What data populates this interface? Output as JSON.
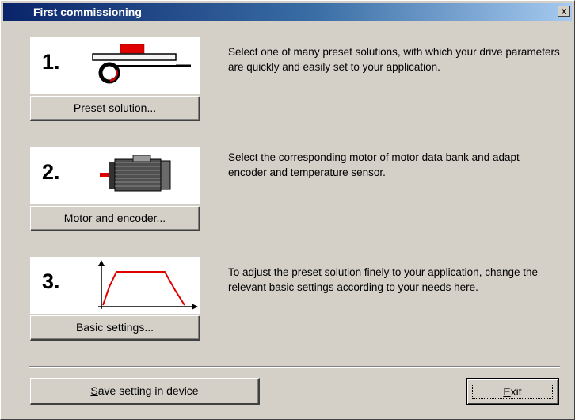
{
  "window": {
    "title": "First commissioning",
    "close_label": "x"
  },
  "steps": [
    {
      "number": "1.",
      "icon": "preset-solution-icon",
      "button_label": "Preset solution...",
      "description": "Select one of many preset solutions, with which your drive parameters are quickly and easily set to your application."
    },
    {
      "number": "2.",
      "icon": "motor-icon",
      "button_label": "Motor and encoder...",
      "description": "Select the corresponding motor of motor data bank and adapt encoder and temperature sensor."
    },
    {
      "number": "3.",
      "icon": "motion-profile-icon",
      "button_label": "Basic settings...",
      "description": "To adjust the preset solution finely to your application, change the relevant basic settings according to your needs here."
    }
  ],
  "footer": {
    "save_mnemonic": "S",
    "save_rest": "ave setting in device",
    "exit_mnemonic": "E",
    "exit_rest": "xit"
  },
  "colors": {
    "face": "#d4d0c8",
    "title_gradient_start": "#0a246a",
    "title_gradient_end": "#a6caf0",
    "accent_red": "#e00000"
  }
}
